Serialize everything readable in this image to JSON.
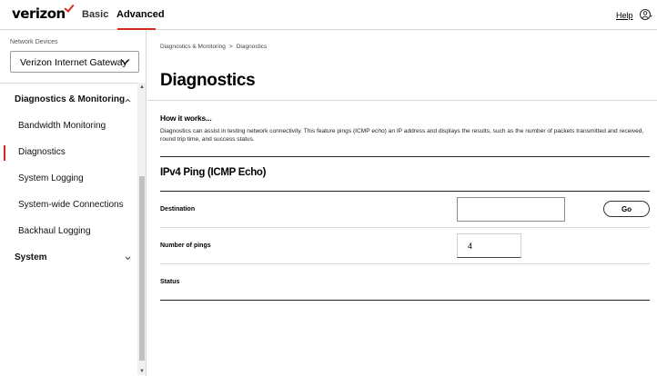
{
  "header": {
    "brand": "verizon",
    "tabs": [
      {
        "label": "Basic",
        "active": false
      },
      {
        "label": "Advanced",
        "active": true
      }
    ],
    "help_label": "Help",
    "accent_color": "#d52b1e"
  },
  "sidebar": {
    "network_devices_label": "Network Devices",
    "selected_device": "Verizon Internet Gateway",
    "items": [
      {
        "label": "Diagnostics & Monitoring",
        "type": "group",
        "expanded": true
      },
      {
        "label": "Bandwidth Monitoring",
        "type": "item"
      },
      {
        "label": "Diagnostics",
        "type": "item",
        "active": true
      },
      {
        "label": "System Logging",
        "type": "item"
      },
      {
        "label": "System-wide Connections",
        "type": "item"
      },
      {
        "label": "Backhaul Logging",
        "type": "item"
      },
      {
        "label": "System",
        "type": "group",
        "expanded": false
      }
    ]
  },
  "main": {
    "breadcrumb": [
      "Diagnostics & Monitoring",
      "Diagnostics"
    ],
    "breadcrumb_separator": ">",
    "title": "Diagnostics",
    "how_title": "How it works...",
    "how_text": "Diagnostics can assist in testing network connectivity. This feature pings (ICMP echo) an IP address and displays the results, such as the number of packets transmitted and received, round trip time, and success status.",
    "ping_section_title": "IPv4 Ping (ICMP Echo)",
    "destination_label": "Destination",
    "destination_value": "",
    "go_label": "Go",
    "pings_label": "Number of pings",
    "pings_value": "4",
    "status_label": "Status"
  }
}
